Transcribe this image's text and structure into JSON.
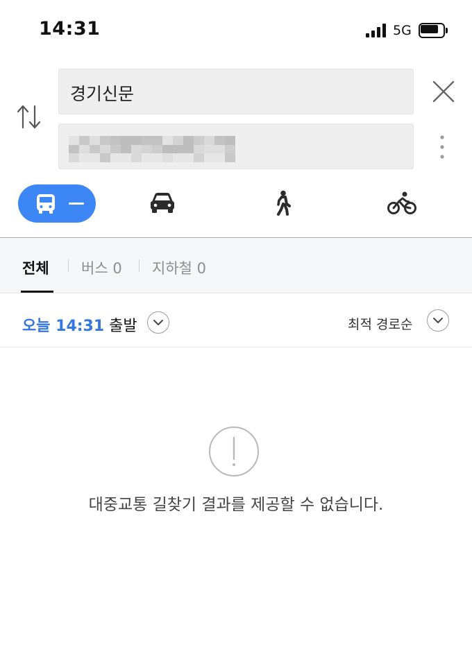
{
  "status_bar": {
    "time": "14:31",
    "network": "5G",
    "icons": [
      "signal-icon",
      "battery-icon"
    ]
  },
  "search": {
    "origin": "경기신문",
    "destination_redacted": true,
    "icons": [
      "swap-icon",
      "close-icon",
      "more-icon"
    ]
  },
  "modes": {
    "active": "transit",
    "transit_summary": "—",
    "items": [
      "transit",
      "car",
      "walk",
      "bicycle"
    ],
    "accent_color": "#3d86f5"
  },
  "tabs": [
    {
      "label": "전체",
      "active": true
    },
    {
      "label": "버스 0",
      "active": false
    },
    {
      "label": "지하철 0",
      "active": false
    }
  ],
  "departure": {
    "time_label": "오늘 14:31",
    "suffix": "출발",
    "accent_color": "#3577e0"
  },
  "sort": {
    "label": "최적 경로순"
  },
  "empty_state": {
    "message": "대중교통 길찾기 결과를 제공할 수 없습니다.",
    "icon": "alert-icon"
  }
}
